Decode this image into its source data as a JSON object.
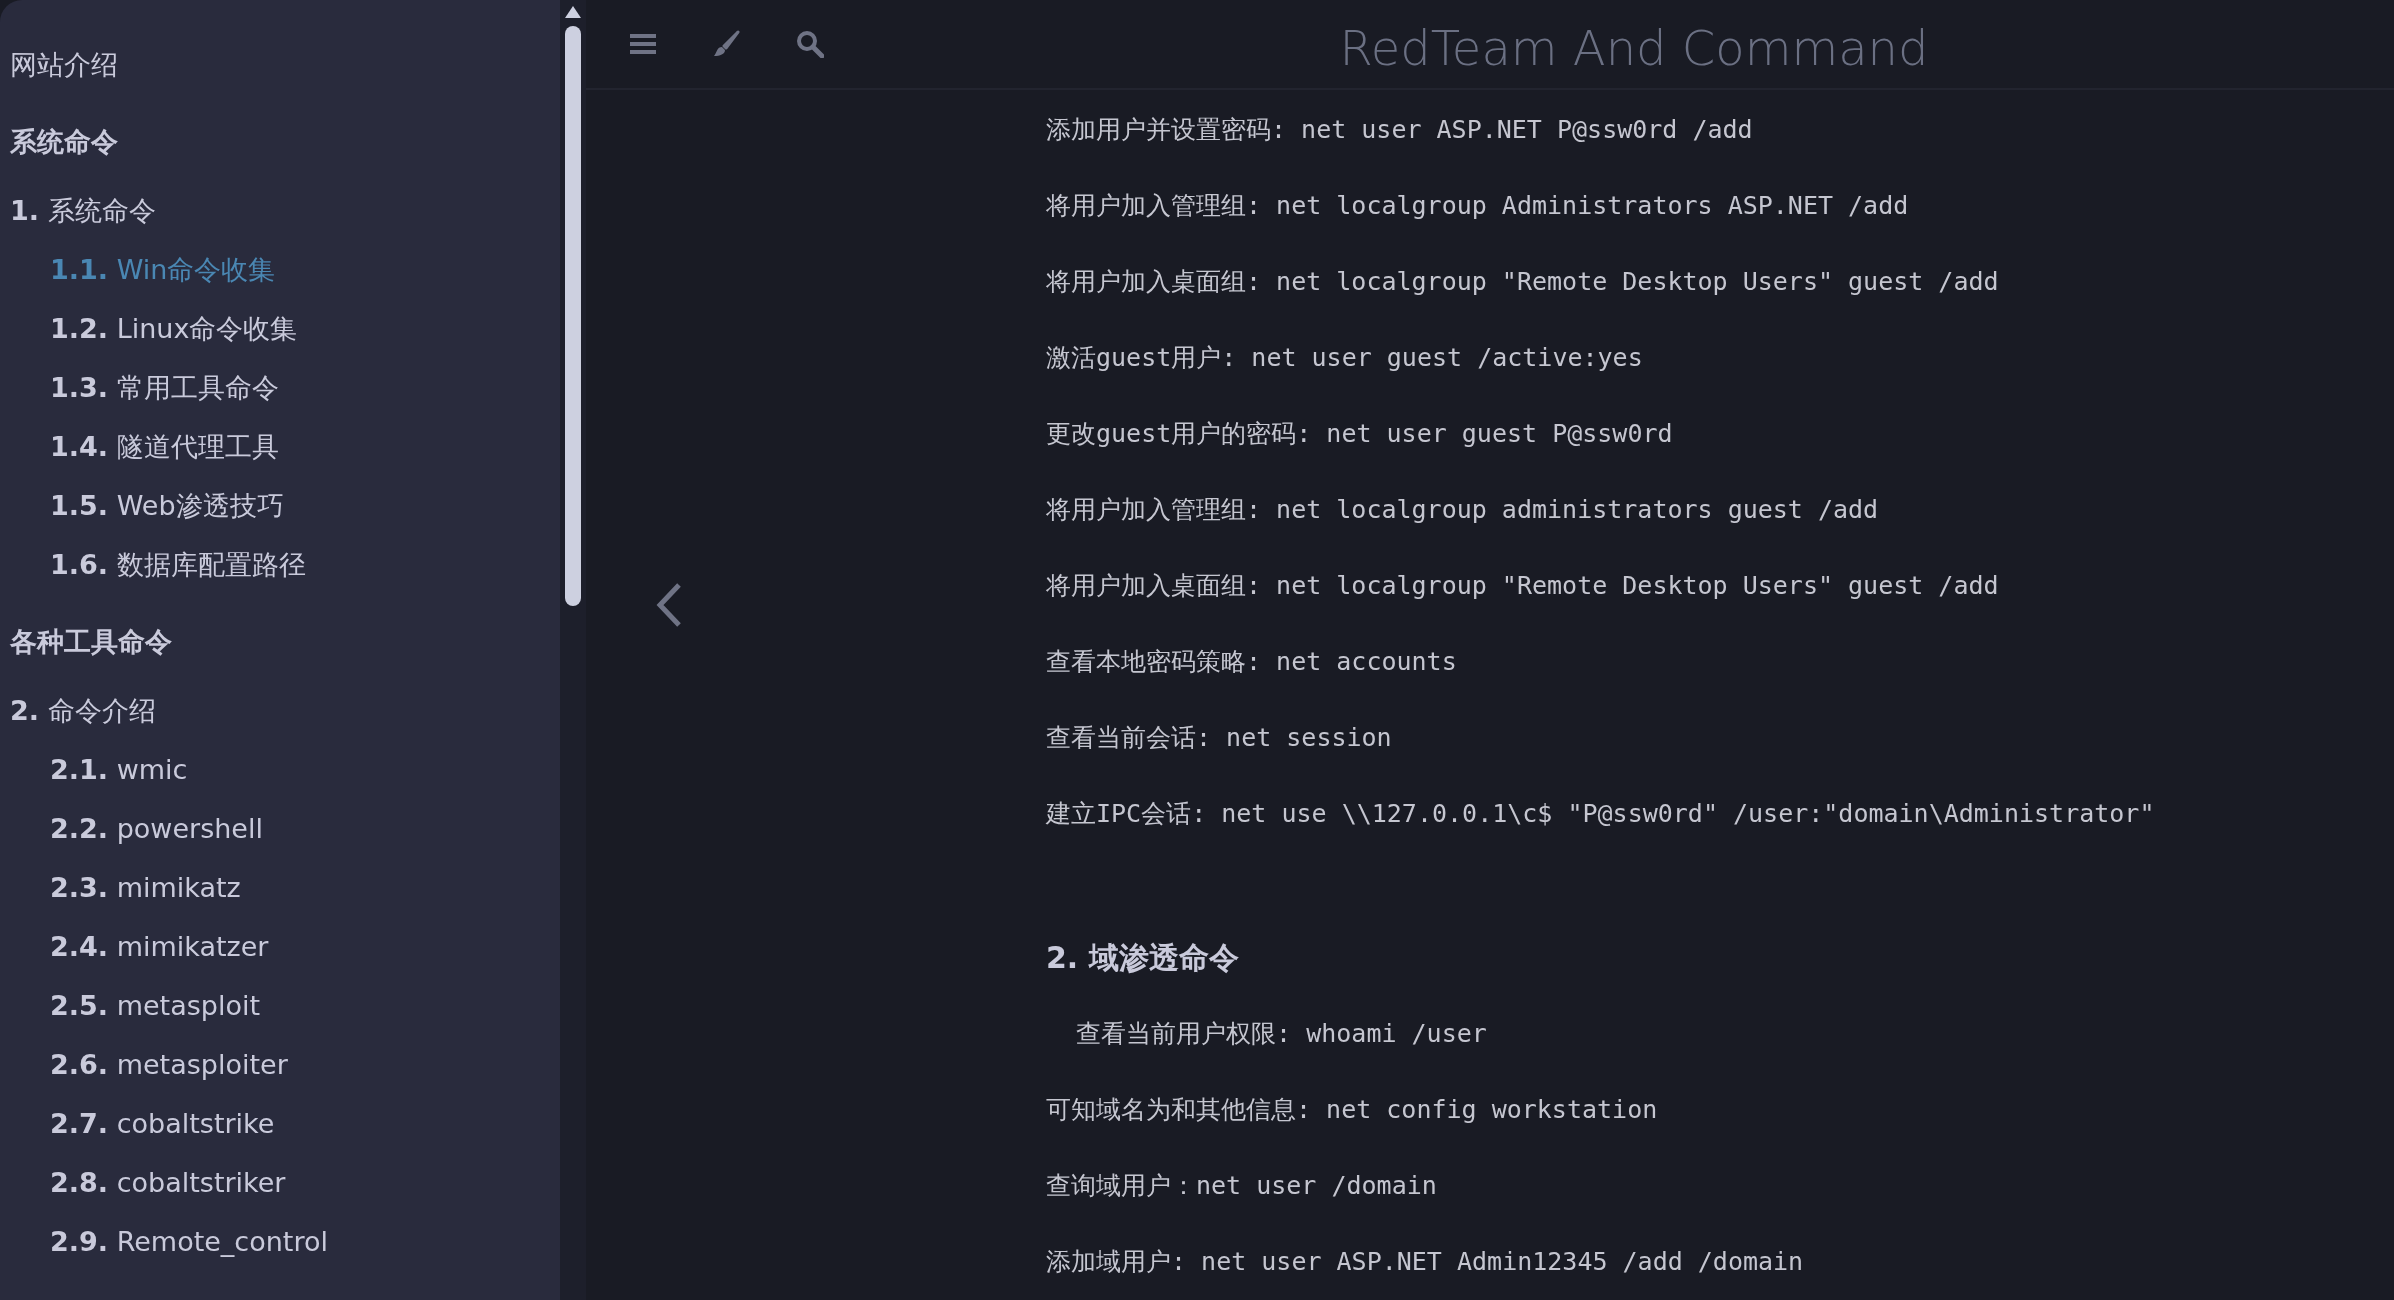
{
  "sidebar": {
    "items": [
      {
        "kind": "link",
        "label": "网站介绍"
      },
      {
        "kind": "part",
        "label": "系统命令"
      },
      {
        "kind": "chapter",
        "number": "1.",
        "label": "系统命令",
        "selected": false,
        "children": [
          {
            "number": "1.1.",
            "label": "Win命令收集",
            "selected": true
          },
          {
            "number": "1.2.",
            "label": "Linux命令收集",
            "selected": false
          },
          {
            "number": "1.3.",
            "label": "常用工具命令",
            "selected": false
          },
          {
            "number": "1.4.",
            "label": "隧道代理工具",
            "selected": false
          },
          {
            "number": "1.5.",
            "label": "Web渗透技巧",
            "selected": false
          },
          {
            "number": "1.6.",
            "label": "数据库配置路径",
            "selected": false
          }
        ]
      },
      {
        "kind": "part",
        "label": "各种工具命令"
      },
      {
        "kind": "chapter",
        "number": "2.",
        "label": "命令介绍",
        "selected": false,
        "children": [
          {
            "number": "2.1.",
            "label": "wmic",
            "selected": false
          },
          {
            "number": "2.2.",
            "label": "powershell",
            "selected": false
          },
          {
            "number": "2.3.",
            "label": "mimikatz",
            "selected": false
          },
          {
            "number": "2.4.",
            "label": "mimikatzer",
            "selected": false
          },
          {
            "number": "2.5.",
            "label": "metasploit",
            "selected": false
          },
          {
            "number": "2.6.",
            "label": "metasploiter",
            "selected": false
          },
          {
            "number": "2.7.",
            "label": "cobaltstrike",
            "selected": false
          },
          {
            "number": "2.8.",
            "label": "cobaltstriker",
            "selected": false
          },
          {
            "number": "2.9.",
            "label": "Remote_control",
            "selected": false
          }
        ]
      }
    ]
  },
  "toolbar": {
    "title": "RedTeam And Command"
  },
  "content": [
    {
      "kind": "paragraph",
      "text": "添加用户并设置密码: net user ASP.NET P@ssw0rd /add"
    },
    {
      "kind": "paragraph",
      "text": "将用户加入管理组: net localgroup Administrators ASP.NET /add"
    },
    {
      "kind": "paragraph",
      "text": "将用户加入桌面组: net localgroup \"Remote Desktop Users\" guest /add"
    },
    {
      "kind": "paragraph",
      "text": "激活guest用户: net user guest /active:yes"
    },
    {
      "kind": "paragraph",
      "text": "更改guest用户的密码: net user guest P@ssw0rd"
    },
    {
      "kind": "paragraph",
      "text": "将用户加入管理组: net localgroup administrators guest /add"
    },
    {
      "kind": "paragraph",
      "text": "将用户加入桌面组: net localgroup \"Remote Desktop Users\" guest /add"
    },
    {
      "kind": "paragraph",
      "text": "查看本地密码策略: net accounts"
    },
    {
      "kind": "paragraph",
      "text": "查看当前会话: net session"
    },
    {
      "kind": "paragraph",
      "text": "建立IPC会话: net use \\\\127.0.0.1\\c$ \"P@ssw0rd\" /user:\"domain\\Administrator\""
    },
    {
      "kind": "heading",
      "text": "2. 域渗透命令"
    },
    {
      "kind": "paragraph",
      "text": "  查看当前用户权限: whoami /user"
    },
    {
      "kind": "paragraph",
      "text": "可知域名为和其他信息: net config workstation"
    },
    {
      "kind": "paragraph",
      "text": "查询域用户：net user /domain"
    },
    {
      "kind": "paragraph",
      "text": "添加域用户: net user ASP.NET Admin12345 /add /domain"
    }
  ]
}
